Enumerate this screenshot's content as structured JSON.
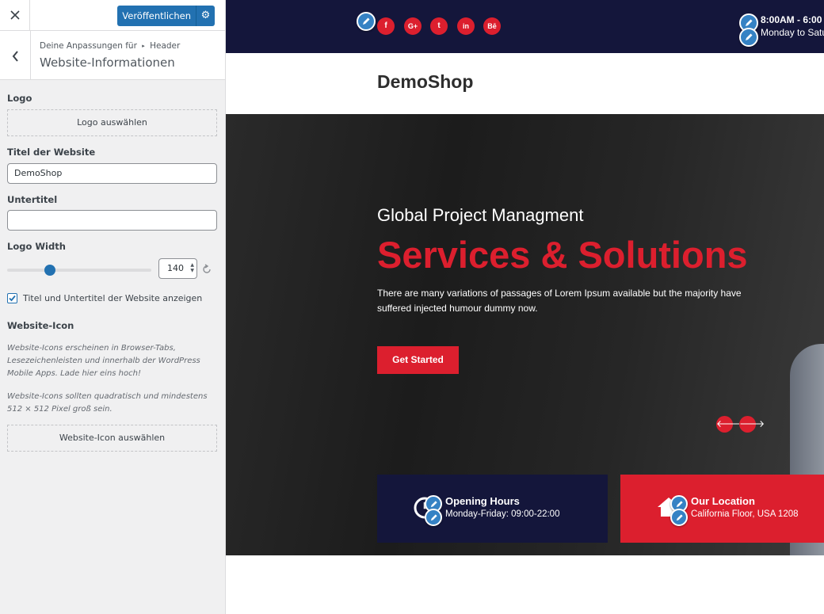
{
  "customizer": {
    "close_icon": "close-icon",
    "publish_label": "Veröffentlichen",
    "publish_settings_icon": "gear-icon",
    "breadcrumb_prefix": "Deine Anpassungen für",
    "breadcrumb_parent": "Header",
    "section_title": "Website-Informationen",
    "logo": {
      "label": "Logo",
      "button": "Logo auswählen"
    },
    "site_title": {
      "label": "Titel der Website",
      "value": "DemoShop"
    },
    "tagline": {
      "label": "Untertitel",
      "value": ""
    },
    "logo_width": {
      "label": "Logo Width",
      "value": "140"
    },
    "display_title_tagline": {
      "label": "Titel und Untertitel der Website anzeigen",
      "checked": true
    },
    "site_icon": {
      "label": "Website-Icon",
      "description_1": "Website-Icons erscheinen in Browser-Tabs, Lesezeichenleisten und innerhalb der WordPress Mobile Apps. Lade hier eins hoch!",
      "description_2": "Website-Icons sollten quadratisch und mindestens 512 × 512 Pixel groß sein.",
      "button": "Website-Icon auswählen"
    }
  },
  "preview": {
    "topbar": {
      "social_icons": [
        "facebook-icon",
        "google-plus-icon",
        "twitter-icon",
        "linkedin-icon",
        "behance-icon"
      ],
      "social_glyphs": [
        "f",
        "G+",
        "t",
        "in",
        "Bē"
      ],
      "hours": "8:00AM - 6:00",
      "days": "Monday to Satu",
      "bg_color": "#14163b"
    },
    "site_title": "DemoShop",
    "hero": {
      "kicker": "Global Project Managment",
      "headline": "Services & Solutions",
      "text": "There are many variations of passages of Lorem Ipsum available but the majority have suffered injected humour dummy now.",
      "cta": "Get Started",
      "prev_glyph": "🡐",
      "next_glyph": "🡒"
    },
    "info_boxes": [
      {
        "title": "Opening Hours",
        "subtitle": "Monday-Friday: 09:00-22:00",
        "icon": "clock-icon",
        "bg_color": "#14163b"
      },
      {
        "title": "Our Location",
        "subtitle": "California Floor, USA 1208",
        "icon": "home-icon",
        "bg_color": "#dc1f2e"
      }
    ],
    "accent_color": "#dc1f2e"
  }
}
